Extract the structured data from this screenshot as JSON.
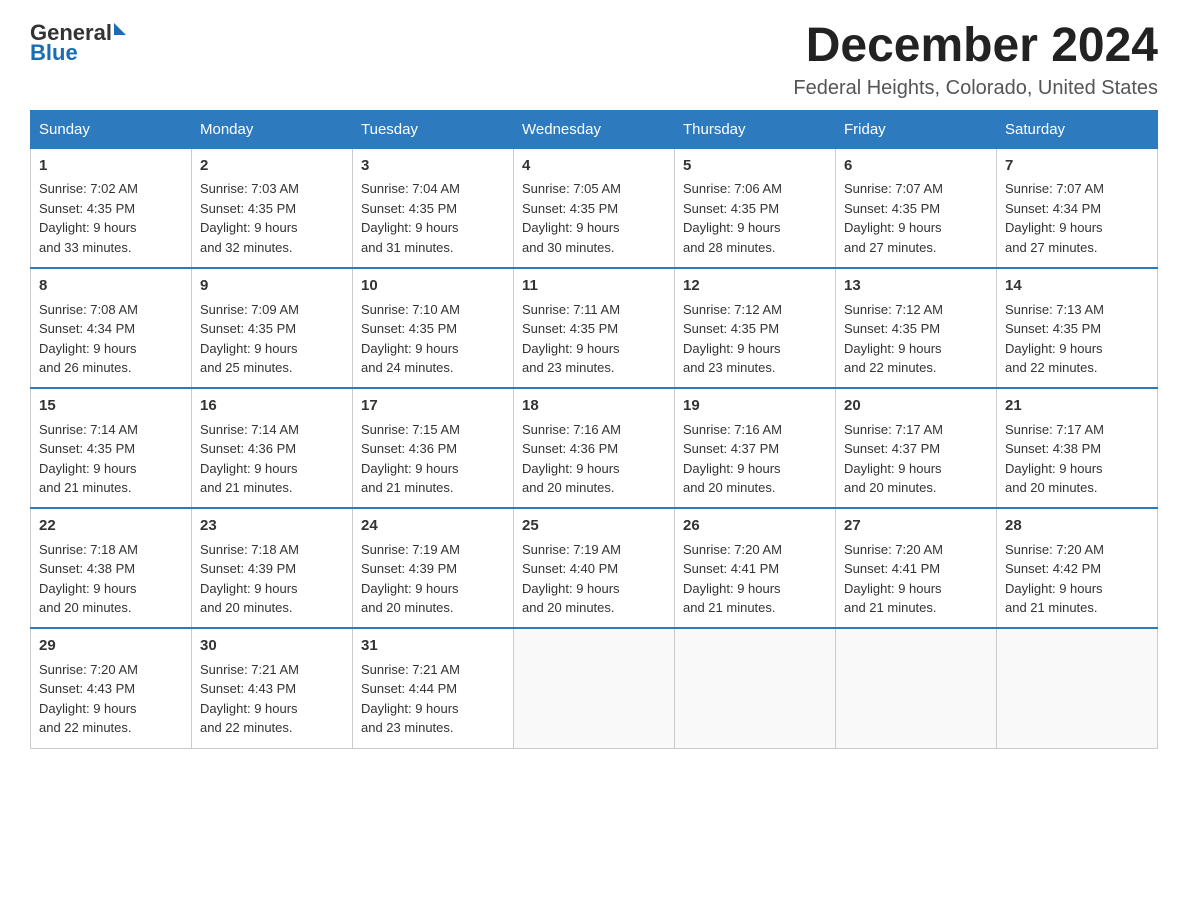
{
  "logo": {
    "general": "General",
    "blue": "Blue"
  },
  "header": {
    "title": "December 2024",
    "subtitle": "Federal Heights, Colorado, United States"
  },
  "weekdays": [
    "Sunday",
    "Monday",
    "Tuesday",
    "Wednesday",
    "Thursday",
    "Friday",
    "Saturday"
  ],
  "weeks": [
    [
      {
        "day": 1,
        "sunrise": "7:02 AM",
        "sunset": "4:35 PM",
        "daylight": "9 hours and 33 minutes."
      },
      {
        "day": 2,
        "sunrise": "7:03 AM",
        "sunset": "4:35 PM",
        "daylight": "9 hours and 32 minutes."
      },
      {
        "day": 3,
        "sunrise": "7:04 AM",
        "sunset": "4:35 PM",
        "daylight": "9 hours and 31 minutes."
      },
      {
        "day": 4,
        "sunrise": "7:05 AM",
        "sunset": "4:35 PM",
        "daylight": "9 hours and 30 minutes."
      },
      {
        "day": 5,
        "sunrise": "7:06 AM",
        "sunset": "4:35 PM",
        "daylight": "9 hours and 28 minutes."
      },
      {
        "day": 6,
        "sunrise": "7:07 AM",
        "sunset": "4:35 PM",
        "daylight": "9 hours and 27 minutes."
      },
      {
        "day": 7,
        "sunrise": "7:07 AM",
        "sunset": "4:34 PM",
        "daylight": "9 hours and 27 minutes."
      }
    ],
    [
      {
        "day": 8,
        "sunrise": "7:08 AM",
        "sunset": "4:34 PM",
        "daylight": "9 hours and 26 minutes."
      },
      {
        "day": 9,
        "sunrise": "7:09 AM",
        "sunset": "4:35 PM",
        "daylight": "9 hours and 25 minutes."
      },
      {
        "day": 10,
        "sunrise": "7:10 AM",
        "sunset": "4:35 PM",
        "daylight": "9 hours and 24 minutes."
      },
      {
        "day": 11,
        "sunrise": "7:11 AM",
        "sunset": "4:35 PM",
        "daylight": "9 hours and 23 minutes."
      },
      {
        "day": 12,
        "sunrise": "7:12 AM",
        "sunset": "4:35 PM",
        "daylight": "9 hours and 23 minutes."
      },
      {
        "day": 13,
        "sunrise": "7:12 AM",
        "sunset": "4:35 PM",
        "daylight": "9 hours and 22 minutes."
      },
      {
        "day": 14,
        "sunrise": "7:13 AM",
        "sunset": "4:35 PM",
        "daylight": "9 hours and 22 minutes."
      }
    ],
    [
      {
        "day": 15,
        "sunrise": "7:14 AM",
        "sunset": "4:35 PM",
        "daylight": "9 hours and 21 minutes."
      },
      {
        "day": 16,
        "sunrise": "7:14 AM",
        "sunset": "4:36 PM",
        "daylight": "9 hours and 21 minutes."
      },
      {
        "day": 17,
        "sunrise": "7:15 AM",
        "sunset": "4:36 PM",
        "daylight": "9 hours and 21 minutes."
      },
      {
        "day": 18,
        "sunrise": "7:16 AM",
        "sunset": "4:36 PM",
        "daylight": "9 hours and 20 minutes."
      },
      {
        "day": 19,
        "sunrise": "7:16 AM",
        "sunset": "4:37 PM",
        "daylight": "9 hours and 20 minutes."
      },
      {
        "day": 20,
        "sunrise": "7:17 AM",
        "sunset": "4:37 PM",
        "daylight": "9 hours and 20 minutes."
      },
      {
        "day": 21,
        "sunrise": "7:17 AM",
        "sunset": "4:38 PM",
        "daylight": "9 hours and 20 minutes."
      }
    ],
    [
      {
        "day": 22,
        "sunrise": "7:18 AM",
        "sunset": "4:38 PM",
        "daylight": "9 hours and 20 minutes."
      },
      {
        "day": 23,
        "sunrise": "7:18 AM",
        "sunset": "4:39 PM",
        "daylight": "9 hours and 20 minutes."
      },
      {
        "day": 24,
        "sunrise": "7:19 AM",
        "sunset": "4:39 PM",
        "daylight": "9 hours and 20 minutes."
      },
      {
        "day": 25,
        "sunrise": "7:19 AM",
        "sunset": "4:40 PM",
        "daylight": "9 hours and 20 minutes."
      },
      {
        "day": 26,
        "sunrise": "7:20 AM",
        "sunset": "4:41 PM",
        "daylight": "9 hours and 21 minutes."
      },
      {
        "day": 27,
        "sunrise": "7:20 AM",
        "sunset": "4:41 PM",
        "daylight": "9 hours and 21 minutes."
      },
      {
        "day": 28,
        "sunrise": "7:20 AM",
        "sunset": "4:42 PM",
        "daylight": "9 hours and 21 minutes."
      }
    ],
    [
      {
        "day": 29,
        "sunrise": "7:20 AM",
        "sunset": "4:43 PM",
        "daylight": "9 hours and 22 minutes."
      },
      {
        "day": 30,
        "sunrise": "7:21 AM",
        "sunset": "4:43 PM",
        "daylight": "9 hours and 22 minutes."
      },
      {
        "day": 31,
        "sunrise": "7:21 AM",
        "sunset": "4:44 PM",
        "daylight": "9 hours and 23 minutes."
      },
      null,
      null,
      null,
      null
    ]
  ]
}
